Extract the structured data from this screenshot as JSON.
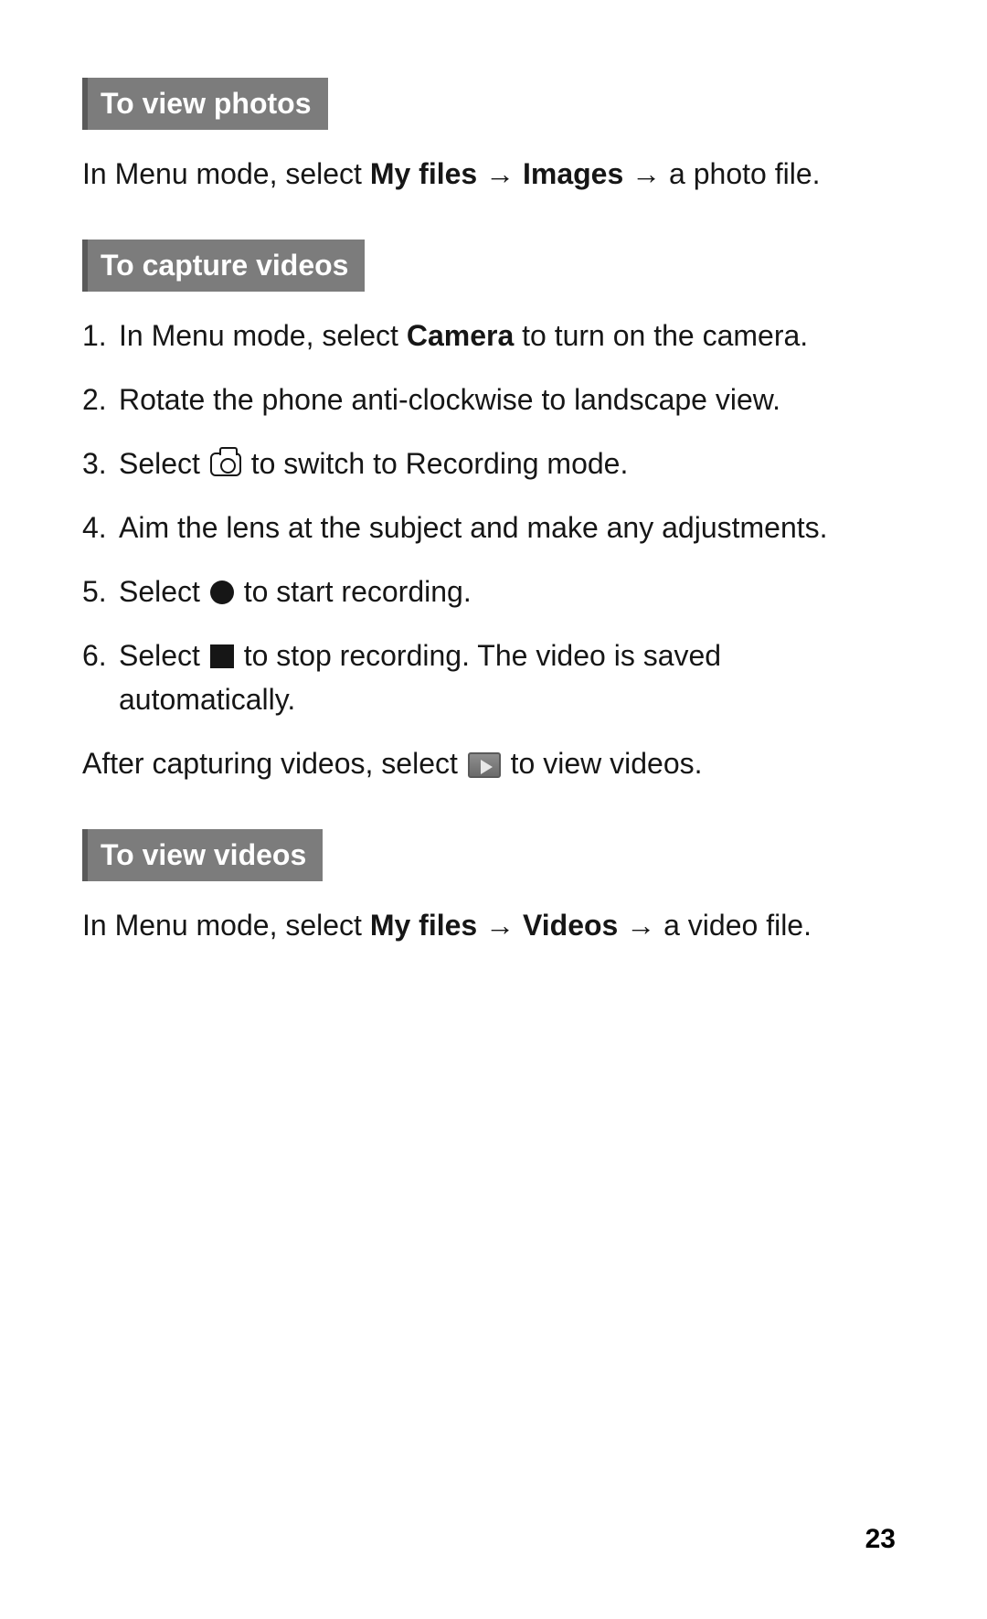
{
  "sections": {
    "view_photos": {
      "heading": "To view photos",
      "text_parts": {
        "p1": "In Menu mode, select ",
        "b1": "My files",
        "arrow1": " → ",
        "b2": "Images",
        "arrow2": " → ",
        "p2": "a photo file."
      }
    },
    "capture_videos": {
      "heading": "To capture videos",
      "steps": {
        "s1a": "In Menu mode, select ",
        "s1b": "Camera",
        "s1c": " to turn on the camera.",
        "s2": "Rotate the phone anti-clockwise to landscape view.",
        "s3a": "Select ",
        "s3b": " to switch to Recording mode.",
        "s4": "Aim the lens at the subject and make any adjustments.",
        "s5a": "Select ",
        "s5b": " to start recording.",
        "s6a": "Select ",
        "s6b": " to stop recording. The video is saved automatically."
      },
      "after_a": "After capturing videos, select ",
      "after_b": " to view videos."
    },
    "view_videos": {
      "heading": "To view videos",
      "text_parts": {
        "p1": "In Menu mode, select ",
        "b1": "My files",
        "arrow1": " → ",
        "b2": "Videos",
        "arrow2": " → ",
        "p2": "a video file."
      }
    }
  },
  "page_number": "23"
}
